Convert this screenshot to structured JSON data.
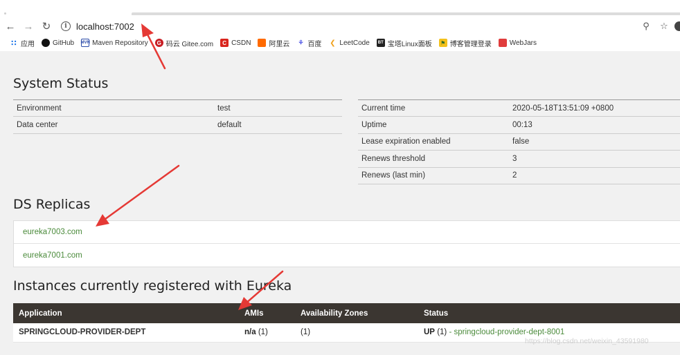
{
  "browser": {
    "url": "localhost:7002",
    "bookmarks": [
      {
        "label": "应用",
        "icon": "apps-grid-icon",
        "glyph": "∷"
      },
      {
        "label": "GitHub",
        "icon": "github-icon",
        "glyph": "●"
      },
      {
        "label": "Maven Repository",
        "icon": "maven-icon",
        "glyph": "MVN"
      },
      {
        "label": "码云 Gitee.com",
        "icon": "gitee-icon",
        "glyph": "G"
      },
      {
        "label": "CSDN",
        "icon": "csdn-icon",
        "glyph": "C"
      },
      {
        "label": "阿里云",
        "icon": "aliyun-icon",
        "glyph": "[-]"
      },
      {
        "label": "百度",
        "icon": "baidu-icon",
        "glyph": "⚘"
      },
      {
        "label": "LeetCode",
        "icon": "leetcode-icon",
        "glyph": "❮"
      },
      {
        "label": "宝塔Linux面板",
        "icon": "bt-panel-icon",
        "glyph": "BT"
      },
      {
        "label": "博客管理登录",
        "icon": "blog-icon",
        "glyph": "⚑"
      },
      {
        "label": "WebJars",
        "icon": "webjars-icon",
        "glyph": "W"
      }
    ]
  },
  "system_status": {
    "title": "System Status",
    "left": [
      {
        "key": "Environment",
        "value": "test"
      },
      {
        "key": "Data center",
        "value": "default"
      }
    ],
    "right": [
      {
        "key": "Current time",
        "value": "2020-05-18T13:51:09 +0800"
      },
      {
        "key": "Uptime",
        "value": "00:13"
      },
      {
        "key": "Lease expiration enabled",
        "value": "false"
      },
      {
        "key": "Renews threshold",
        "value": "3"
      },
      {
        "key": "Renews (last min)",
        "value": "2"
      }
    ]
  },
  "replicas": {
    "title": "DS Replicas",
    "items": [
      "eureka7003.com",
      "eureka7001.com"
    ]
  },
  "instances": {
    "title": "Instances currently registered with Eureka",
    "headers": [
      "Application",
      "AMIs",
      "Availability Zones",
      "Status"
    ],
    "rows": [
      {
        "application": "SPRINGCLOUD-PROVIDER-DEPT",
        "amis_bold": "n/a",
        "amis_count": "(1)",
        "zones": "(1)",
        "status_bold": "UP",
        "status_count": "(1)",
        "status_sep": "-",
        "status_link": "springcloud-provider-dept-8001"
      }
    ]
  },
  "watermark": "https://blog.csdn.net/weixin_43591980",
  "colors": {
    "link": "#4a8a3a",
    "table_header": "#3b3631",
    "page_bg": "#f1f1f1",
    "annotation_arrow": "#e53935"
  }
}
